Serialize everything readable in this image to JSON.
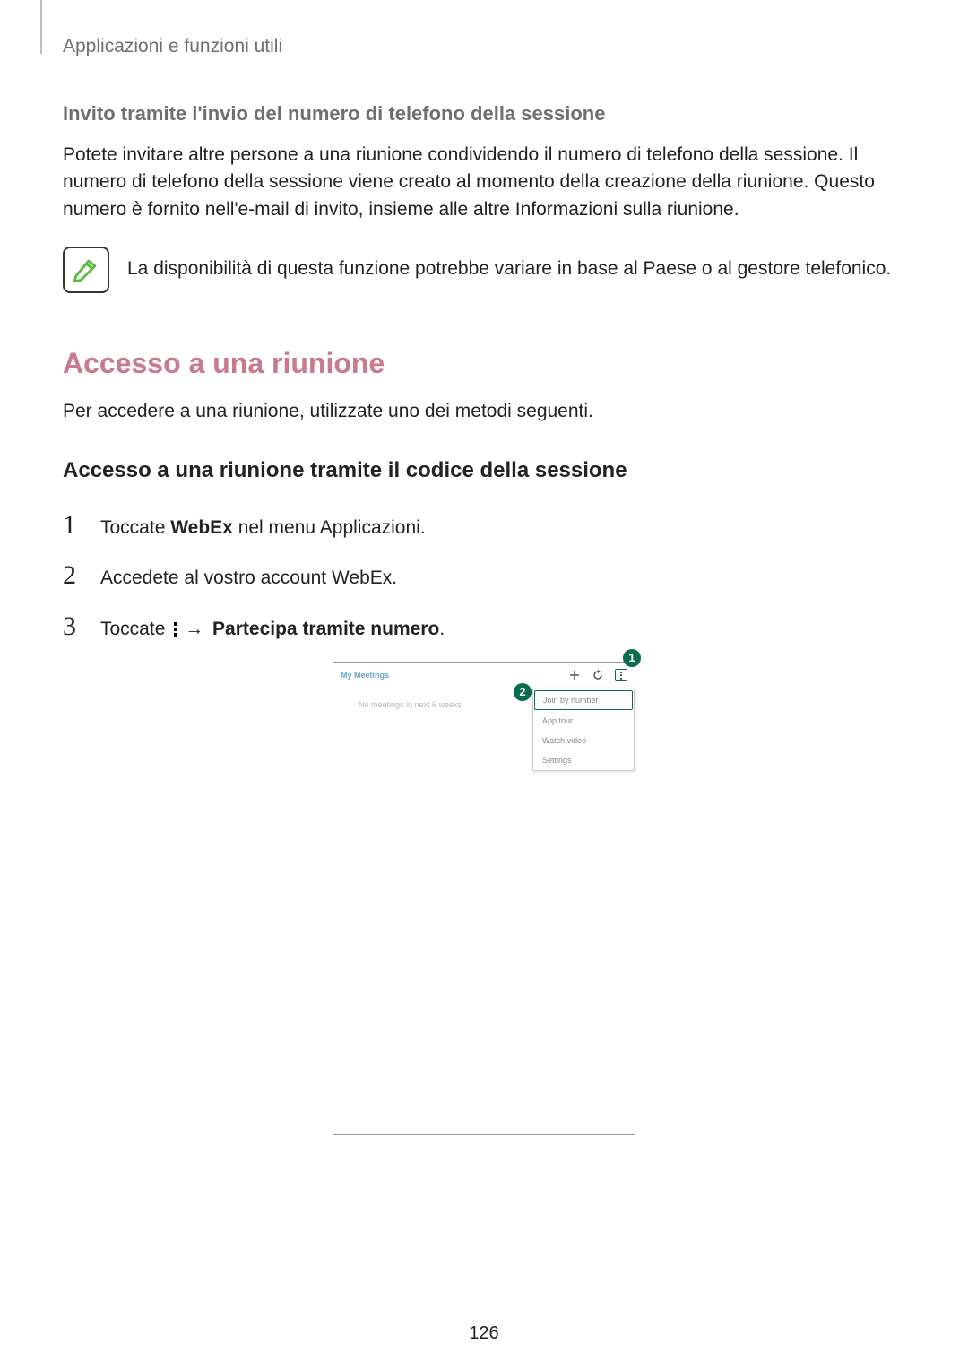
{
  "header": "Applicazioni e funzioni utili",
  "subheading1": "Invito tramite l'invio del numero di telefono della sessione",
  "body1": "Potete invitare altre persone a una riunione condividendo il numero di telefono della sessione. Il numero di telefono della sessione viene creato al momento della creazione della riunione. Questo numero è fornito nell'e-mail di invito, insieme alle altre Informazioni sulla riunione.",
  "noteText": "La disponibilità di questa funzione potrebbe variare in base al Paese o al gestore telefonico.",
  "mainHeading": "Accesso a una riunione",
  "body2": "Per accedere a una riunione, utilizzate uno dei metodi seguenti.",
  "subheading2": "Accesso a una riunione tramite il codice della sessione",
  "steps": {
    "s1": {
      "num": "1",
      "pre": "Toccate ",
      "bold": "WebEx",
      "post": " nel menu Applicazioni."
    },
    "s2": {
      "num": "2",
      "text": "Accedete al vostro account WebEx."
    },
    "s3": {
      "num": "3",
      "pre": "Toccate ",
      "arrow": "→",
      "bold": " Partecipa tramite numero",
      "post": "."
    }
  },
  "phone": {
    "title": "My Meetings",
    "emptyMsg": "No meetings in next 6 weeks",
    "dropdown": [
      "Join by number",
      "App tour",
      "Watch video",
      "Settings"
    ]
  },
  "callouts": {
    "c1": "1",
    "c2": "2"
  },
  "pageNumber": "126"
}
